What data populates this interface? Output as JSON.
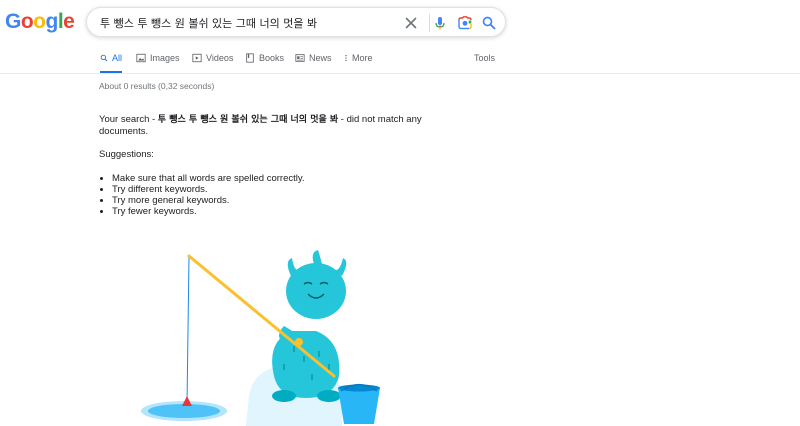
{
  "logo": {
    "letters": [
      "G",
      "o",
      "o",
      "g",
      "l",
      "e"
    ]
  },
  "search": {
    "value": "투 뺑스 투 뺑스 원 볼쉬 있는 그때 너의 멋을 봐"
  },
  "tabs": [
    {
      "label": "All",
      "icon": "search-icon"
    },
    {
      "label": "Images",
      "icon": "image-icon"
    },
    {
      "label": "Videos",
      "icon": "video-icon"
    },
    {
      "label": "Books",
      "icon": "book-icon"
    },
    {
      "label": "News",
      "icon": "news-icon"
    },
    {
      "label": "More",
      "icon": "more-vert-icon"
    }
  ],
  "tools_label": "Tools",
  "result_stats": "About 0 results (0,32 seconds)",
  "no_results": {
    "prefix": "Your search - ",
    "query": "투 뺑스 투 뺑스 원 볼쉬 있는 그때 너의 멋을 봐",
    "suffix": " - did not match any documents."
  },
  "suggestions_title": "Suggestions:",
  "suggestions": [
    "Make sure that all words are spelled correctly.",
    "Try different keywords.",
    "Try more general keywords.",
    "Try fewer keywords."
  ],
  "colors": {
    "blue": "#4285F4",
    "red": "#EA4335",
    "yellow": "#FBBC05",
    "green": "#34A853",
    "accent": "#1a73e8"
  }
}
